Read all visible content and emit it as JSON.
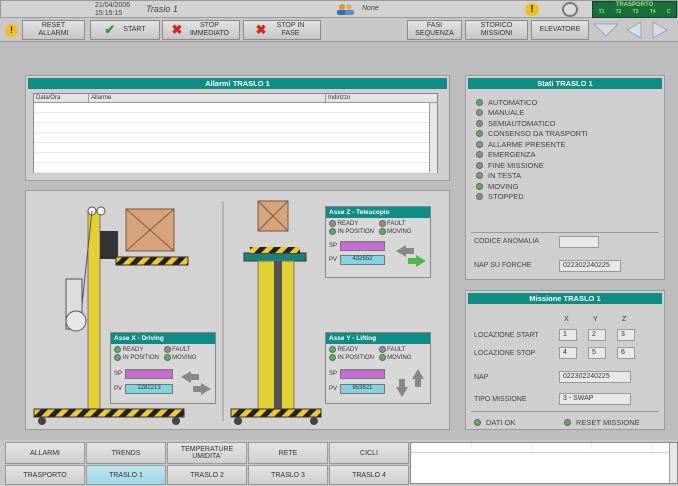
{
  "header": {
    "date": "21/04/2006",
    "time": "15:15:15",
    "title": "Traslo 1",
    "user": "None",
    "module": "TRASPORTO",
    "module_chips": [
      "T1",
      "T2",
      "T3",
      "T4",
      "C"
    ]
  },
  "toolbar": {
    "reset": "RESET ALLARMI",
    "start": "START",
    "stop_immediate": "STOP IMMEDIATO",
    "stop_phase": "STOP IN FASE",
    "phases": "FASI SEQUENZA",
    "history": "STORICO MISSIONI",
    "elevator": "ELEVATORE"
  },
  "alarms": {
    "title": "Allarmi TRASLO 1",
    "col_date": "Data/Ora",
    "col_alarm": "Allarme",
    "col_addr": "Indirizzo"
  },
  "status": {
    "title": "Stati TRASLO 1",
    "items": [
      {
        "label": "AUTOMATICO",
        "on": true
      },
      {
        "label": "MANUALE",
        "on": false
      },
      {
        "label": "SEMIAUTOMATICO",
        "on": false
      },
      {
        "label": "CONSENSO DA TRASPORTI",
        "on": true
      },
      {
        "label": "ALLARME PRESENTE",
        "on": false
      },
      {
        "label": "EMERGENZA",
        "on": false
      },
      {
        "label": "FINE MISSIONE",
        "on": false
      },
      {
        "label": "IN TESTA",
        "on": false
      },
      {
        "label": "MOVING",
        "on": true
      },
      {
        "label": "STOPPED",
        "on": false
      }
    ],
    "anomaly_label": "CODICE ANOMALIA",
    "anomaly_value": "",
    "nap_fork_label": "NAP SU FORCHE",
    "nap_fork_value": "022302240225"
  },
  "mission": {
    "title": "Missione TRASLO 1",
    "x": "X",
    "y": "Y",
    "z": "Z",
    "start_label": "LOCAZIONE START",
    "start": [
      "1",
      "2",
      "3"
    ],
    "stop_label": "LOCAZIONE STOP",
    "stop": [
      "4",
      "5",
      "6"
    ],
    "nap_label": "NAP",
    "nap_value": "022302240225",
    "type_label": "TIPO MISSIONE",
    "type_value": "3 - SWAP",
    "dati_ok": "DATI OK",
    "reset": "RESET MISSIONE"
  },
  "axes": {
    "z": {
      "title": "Asse Z - Telescopio",
      "ready": "READY",
      "fault": "FAULT",
      "inpos": "IN POSITION",
      "moving": "MOVING",
      "sp": "SP",
      "pv": "PV",
      "pv_value": "432652"
    },
    "x": {
      "title": "Asse X - Driving",
      "ready": "READY",
      "fault": "FAULT",
      "inpos": "IN POSITION",
      "moving": "MOVING",
      "sp": "SP",
      "pv": "PV",
      "pv_value": "1282213"
    },
    "y": {
      "title": "Asse Y - Lifting",
      "ready": "READY",
      "fault": "FAULT",
      "inpos": "IN POSITION",
      "moving": "MOVING",
      "sp": "SP",
      "pv": "PV",
      "pv_value": "853621"
    }
  },
  "tabs_row1": [
    "ALLARMI",
    "TRENDS",
    "TEMPERATURE UMIDITA'",
    "RETE",
    "CICLI"
  ],
  "tabs_row2": [
    "TRASPORTO",
    "TRASLO 1",
    "TRASLO 2",
    "TRASLO 3",
    "TRASLO 4"
  ]
}
